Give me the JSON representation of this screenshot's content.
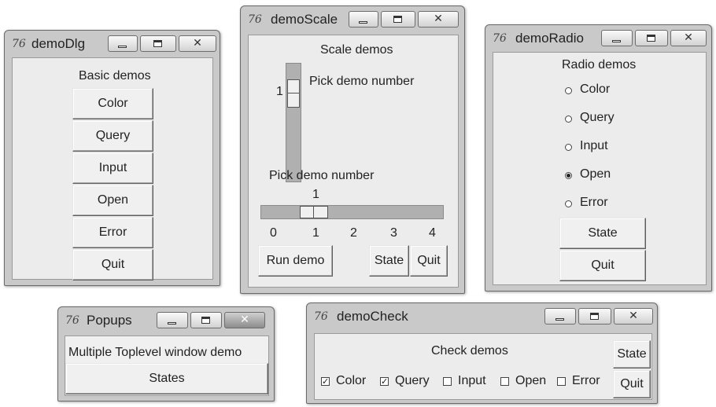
{
  "tk_icon": "76",
  "close_glyph": "✕",
  "windows": {
    "dlg": {
      "title": "demoDlg",
      "header": "Basic demos",
      "buttons": [
        "Color",
        "Query",
        "Input",
        "Open",
        "Error",
        "Quit"
      ]
    },
    "scale": {
      "title": "demoScale",
      "header": "Scale demos",
      "vertical_label": "Pick demo number",
      "vertical_value": "1",
      "horizontal_label": "Pick demo number",
      "horizontal_value": "1",
      "ticks": [
        "0",
        "1",
        "2",
        "3",
        "4"
      ],
      "run_button": "Run demo",
      "state_button": "State",
      "quit_button": "Quit"
    },
    "radio": {
      "title": "demoRadio",
      "header": "Radio demos",
      "options": [
        "Color",
        "Query",
        "Input",
        "Open",
        "Error"
      ],
      "selected": "Open",
      "state_button": "State",
      "quit_button": "Quit"
    },
    "popups": {
      "title": "Popups",
      "label": "Multiple Toplevel window demo",
      "button": "States"
    },
    "check": {
      "title": "demoCheck",
      "header": "Check demos",
      "items": [
        "Color",
        "Query",
        "Input",
        "Open",
        "Error"
      ],
      "checked": [
        "Color",
        "Query"
      ],
      "check_glyph": "✓",
      "state_button": "State",
      "quit_button": "Quit"
    }
  }
}
